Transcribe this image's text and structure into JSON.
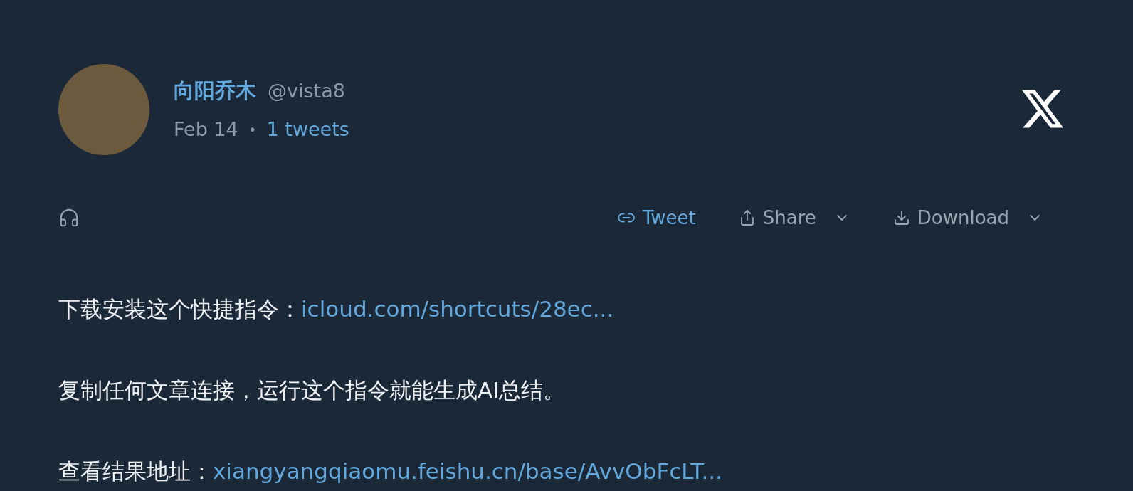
{
  "author": {
    "name": "向阳乔木",
    "handle": "@vista8",
    "date": "Feb 14",
    "separator": "•",
    "tweet_count": "1 tweets"
  },
  "actions": [
    {
      "kind": "link",
      "label": "Tweet",
      "dropdown": false
    },
    {
      "kind": "share",
      "label": "Share",
      "dropdown": true
    },
    {
      "kind": "download",
      "label": "Download",
      "dropdown": true
    }
  ],
  "paragraphs": [
    {
      "text": "下载安装这个快捷指令：",
      "link": "icloud.com/shortcuts/28ec..."
    },
    {
      "text": "复制任何文章连接，运行这个指令就能生成AI总结。"
    },
    {
      "text": "查看结果地址：",
      "link": "xiangyangqiaomu.feishu.cn/base/AvvObFcLT..."
    }
  ]
}
